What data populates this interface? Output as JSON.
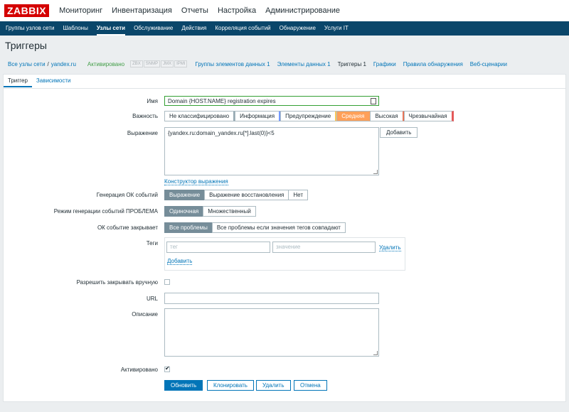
{
  "logo": "ZABBIX",
  "top_menu": [
    "Мониторинг",
    "Инвентаризация",
    "Отчеты",
    "Настройка",
    "Администрирование"
  ],
  "sub_menu": [
    "Группы узлов сети",
    "Шаблоны",
    "Узлы сети",
    "Обслуживание",
    "Действия",
    "Корреляция событий",
    "Обнаружение",
    "Услуги IT"
  ],
  "page_title": "Триггеры",
  "host_nav": {
    "all_hosts": "Все узлы сети",
    "separator": "/",
    "host": "yandex.ru",
    "status": "Активировано",
    "availability": [
      "ZBX",
      "SNMP",
      "JMX",
      "IPMI"
    ],
    "links": [
      "Группы элементов данных 1",
      "Элементы данных 1",
      "Триггеры 1",
      "Графики",
      "Правила обнаружения",
      "Веб-сценарии"
    ]
  },
  "tabs": [
    "Триггер",
    "Зависимости"
  ],
  "form": {
    "name_label": "Имя",
    "name_value": "Domain {HOST.NAME} registration expires",
    "severity_label": "Важность",
    "severity_options": [
      "Не классифицировано",
      "Информация",
      "Предупреждение",
      "Средняя",
      "Высокая",
      "Чрезвычайная"
    ],
    "expression_label": "Выражение",
    "expression_value": "{yandex.ru:domain_yandex.ru[*].last(0)}<5",
    "add_button": "Добавить",
    "constructor_link": "Конструктор выражения",
    "ok_gen_label": "Генерация ОК событий",
    "ok_gen_options": [
      "Выражение",
      "Выражение восстановления",
      "Нет"
    ],
    "problem_mode_label": "Режим генерации событий ПРОБЛЕМА",
    "problem_mode_options": [
      "Одиночная",
      "Множественный"
    ],
    "ok_close_label": "ОК событие закрывает",
    "ok_close_options": [
      "Все проблемы",
      "Все проблемы если значения тегов совпадают"
    ],
    "tags_label": "Теги",
    "tag_placeholder": "тег",
    "value_placeholder": "значение",
    "remove_link": "Удалить",
    "add_link": "Добавить",
    "manual_close_label": "Разрешить закрывать вручную",
    "url_label": "URL",
    "description_label": "Описание",
    "enabled_label": "Активировано"
  },
  "buttons": [
    "Обновить",
    "Клонировать",
    "Удалить",
    "Отмена"
  ],
  "colors": {
    "accent": "#0275b8",
    "header": "#0a466a",
    "logo": "#d40000",
    "severity_average": "#ffa059"
  }
}
